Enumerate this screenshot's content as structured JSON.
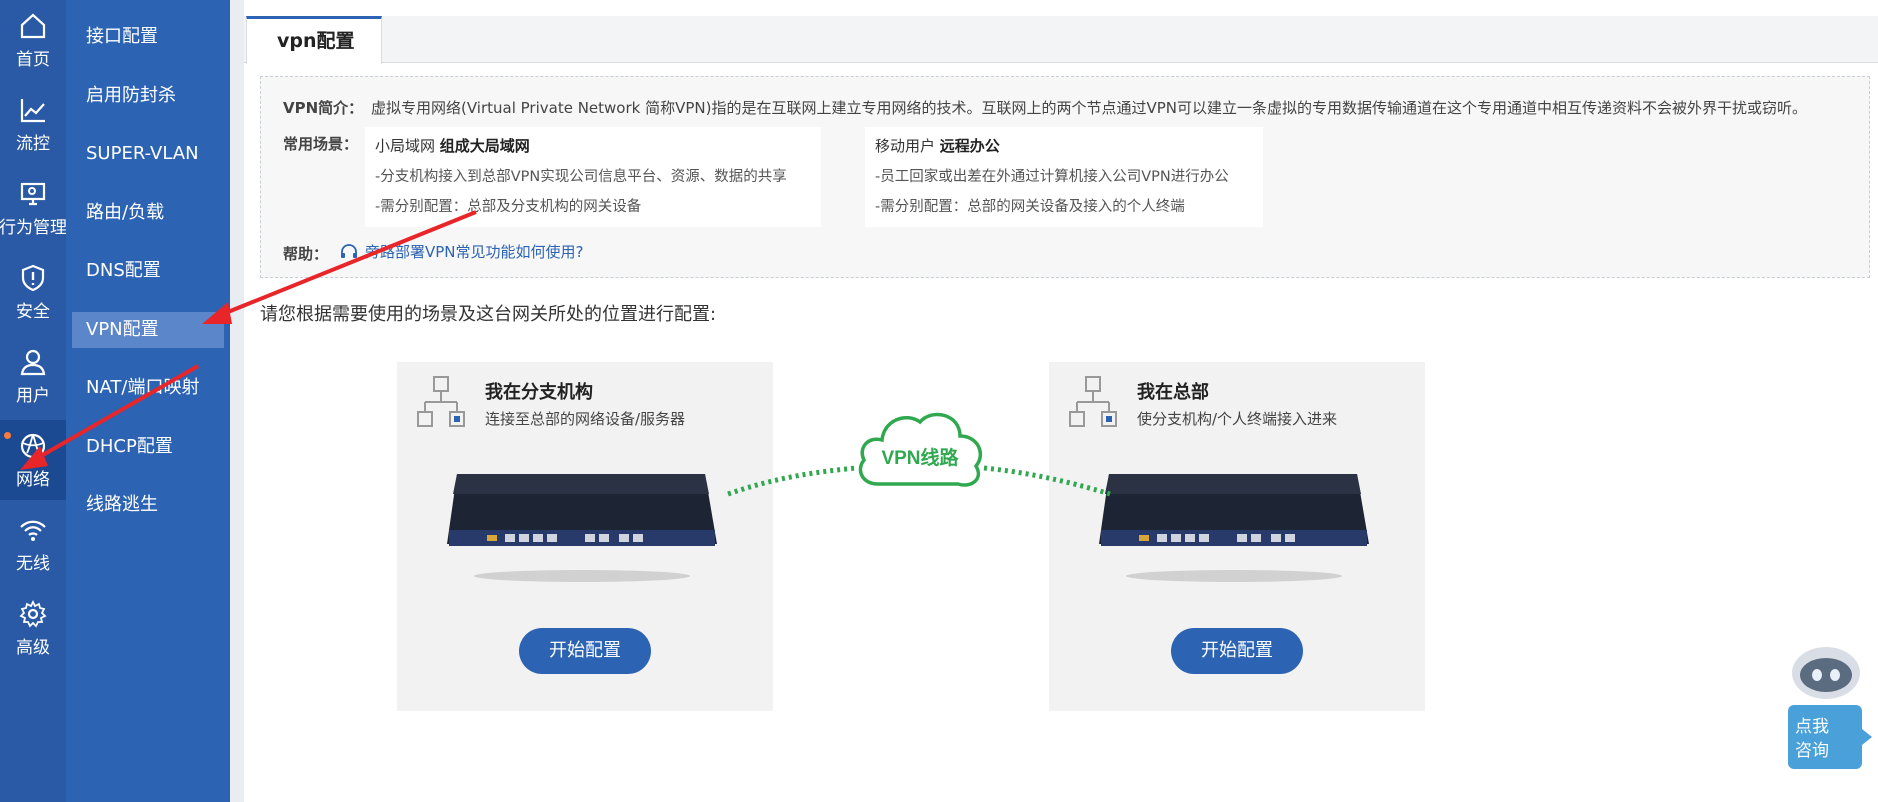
{
  "rail": [
    {
      "label": "首页",
      "icon": "home-icon"
    },
    {
      "label": "流控",
      "icon": "chart-icon"
    },
    {
      "label": "行为管理",
      "icon": "monitor-icon"
    },
    {
      "label": "安全",
      "icon": "shield-icon"
    },
    {
      "label": "用户",
      "icon": "user-icon"
    },
    {
      "label": "网络",
      "icon": "network-icon"
    },
    {
      "label": "无线",
      "icon": "wifi-icon"
    },
    {
      "label": "高级",
      "icon": "gear-icon"
    }
  ],
  "menu": [
    "接口配置",
    "启用防封杀",
    "SUPER-VLAN",
    "路由/负载",
    "DNS配置",
    "VPN配置",
    "NAT/端口映射",
    "DHCP配置",
    "线路逃生"
  ],
  "tab": {
    "title": "vpn配置"
  },
  "intro": {
    "intro_key": "VPN简介：",
    "intro_text": "虚拟专用网络(Virtual Private Network 简称VPN)指的是在互联网上建立专用网络的技术。互联网上的两个节点通过VPN可以建立一条虚拟的专用数据传输通道在这个专用通道中相互传递资料不会被外界干扰或窃听。",
    "scenes_key": "常用场景：",
    "scene_left": {
      "prefix": "小局域网 ",
      "bold": "组成大局域网",
      "line1": "-分支机构接入到总部VPN实现公司信息平台、资源、数据的共享",
      "line2": "-需分别配置：总部及分支机构的网关设备"
    },
    "scene_right": {
      "prefix": "移动用户 ",
      "bold": "远程办公",
      "line1": "-员工回家或出差在外通过计算机接入公司VPN进行办公",
      "line2": "-需分别配置：总部的网关设备及接入的个人终端"
    },
    "help_key": "帮助：",
    "help_link": "旁路部署VPN常见功能如何使用?"
  },
  "prompt": "请您根据需要使用的场景及这台网关所处的位置进行配置:",
  "cards": {
    "branch": {
      "title": "我在分支机构",
      "subtitle": "连接至总部的网络设备/服务器",
      "button": "开始配置"
    },
    "hq": {
      "title": "我在总部",
      "subtitle": "使分支机构/个人终端接入进来",
      "button": "开始配置"
    }
  },
  "cloud_label": "VPN线路",
  "robot": {
    "line1": "点我",
    "line2": "咨询"
  },
  "colors": {
    "rail": "#2a5aa5",
    "menu": "#2d63b3",
    "accent": "#2d63b3",
    "vpn_green": "#2fa84f",
    "arrow_red": "#e8262a"
  }
}
